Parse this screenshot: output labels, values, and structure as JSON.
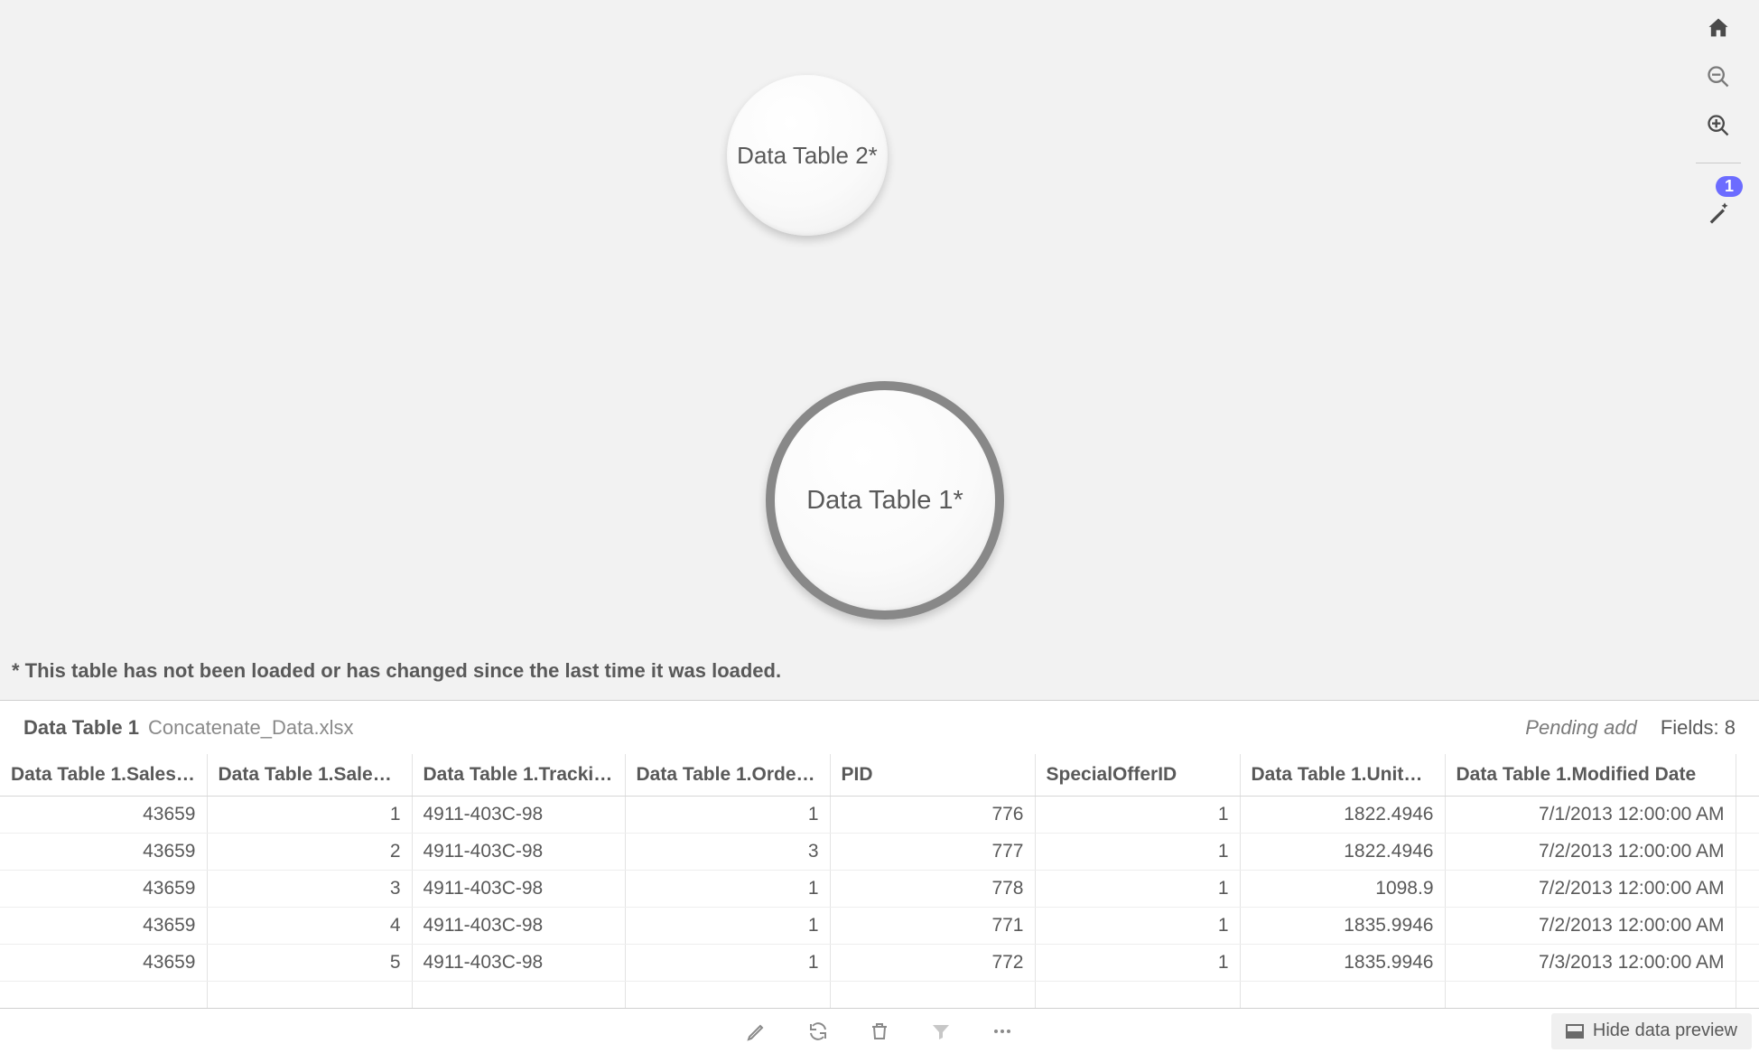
{
  "canvas": {
    "bubble_small_label": "Data Table 2*",
    "bubble_large_label": "Data Table 1*",
    "footnote": "* This table has not been loaded or has changed since the last time it was loaded."
  },
  "toolbar": {
    "home_icon": "home-icon",
    "zoom_out_icon": "zoom-out-icon",
    "zoom_in_icon": "zoom-in-icon",
    "magic_icon": "magic-wand-icon",
    "badge_count": "1"
  },
  "panel": {
    "title": "Data Table 1",
    "file": "Concatenate_Data.xlsx",
    "status": "Pending add",
    "fields_label": "Fields: 8"
  },
  "table": {
    "headers": [
      "Data Table 1.SalesO…",
      "Data Table 1.SalesO…",
      "Data Table 1.Tracking…",
      "Data Table 1.OrderQty",
      "PID",
      "SpecialOfferID",
      "Data Table 1.UnitPrice",
      "Data Table 1.Modified Date"
    ],
    "rows": [
      [
        "43659",
        "1",
        "4911-403C-98",
        "1",
        "776",
        "1",
        "1822.4946",
        "7/1/2013 12:00:00 AM"
      ],
      [
        "43659",
        "2",
        "4911-403C-98",
        "3",
        "777",
        "1",
        "1822.4946",
        "7/2/2013 12:00:00 AM"
      ],
      [
        "43659",
        "3",
        "4911-403C-98",
        "1",
        "778",
        "1",
        "1098.9",
        "7/2/2013 12:00:00 AM"
      ],
      [
        "43659",
        "4",
        "4911-403C-98",
        "1",
        "771",
        "1",
        "1835.9946",
        "7/2/2013 12:00:00 AM"
      ],
      [
        "43659",
        "5",
        "4911-403C-98",
        "1",
        "772",
        "1",
        "1835.9946",
        "7/3/2013 12:00:00 AM"
      ]
    ],
    "partial_row": [
      "",
      "",
      "",
      "",
      "",
      "",
      "",
      ""
    ]
  },
  "bottombar": {
    "edit_icon": "edit-icon",
    "refresh_icon": "refresh-icon",
    "delete_icon": "delete-icon",
    "filter_icon": "filter-icon",
    "more_icon": "more-icon",
    "hide_preview_label": "Hide data preview"
  }
}
